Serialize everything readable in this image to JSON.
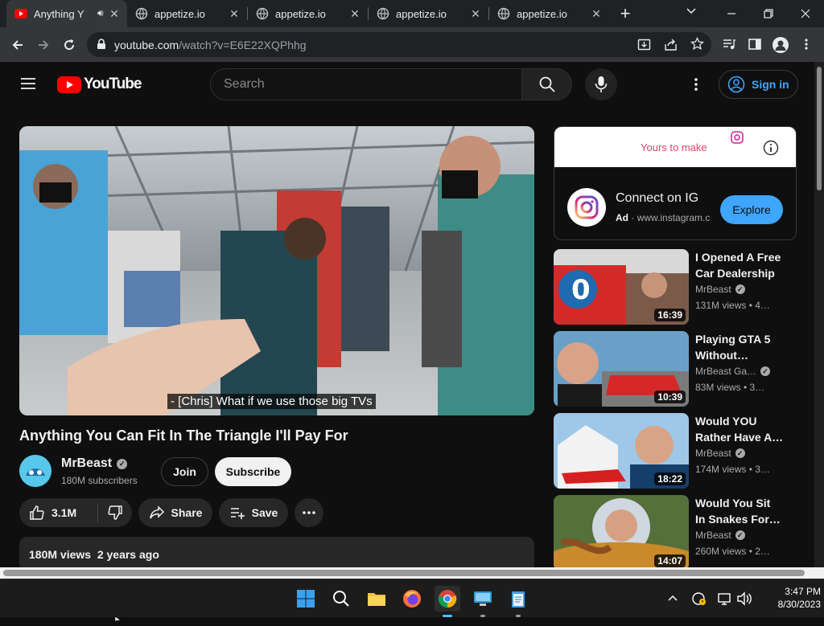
{
  "browser": {
    "tabs": [
      {
        "title": "Anything Yo",
        "active": true
      },
      {
        "title": "appetize.io",
        "active": false
      },
      {
        "title": "appetize.io",
        "active": false
      },
      {
        "title": "appetize.io",
        "active": false
      },
      {
        "title": "appetize.io",
        "active": false
      }
    ],
    "url_host": "youtube.com",
    "url_path": "/watch?v=E6E22XQPhhg"
  },
  "youtube": {
    "logo_text": "YouTube",
    "search_placeholder": "Search",
    "signin_label": "Sign in"
  },
  "video": {
    "caption": "- [Chris] What if we use those big TVs",
    "title": "Anything You Can Fit In The Triangle I'll Pay For",
    "channel_name": "MrBeast",
    "subscribers": "180M subscribers",
    "join_label": "Join",
    "subscribe_label": "Subscribe",
    "likes": "3.1M",
    "share_label": "Share",
    "save_label": "Save",
    "views_date": "180M views  2 years ago"
  },
  "ad": {
    "banner_text": "Yours to make",
    "title": "Connect on IG",
    "ad_label": "Ad",
    "domain": "www.instagram.c",
    "cta_label": "Explore"
  },
  "recommendations": [
    {
      "title_line1": "I Opened A Free",
      "title_line2": "Car Dealership",
      "channel": "MrBeast",
      "meta": "131M views  • 4…",
      "duration": "16:39"
    },
    {
      "title_line1": "Playing GTA 5",
      "title_line2": "Without…",
      "channel": "MrBeast Ga…",
      "meta": "83M views  • 3…",
      "duration": "10:39"
    },
    {
      "title_line1": "Would YOU",
      "title_line2": "Rather Have A…",
      "channel": "MrBeast",
      "meta": "174M views  • 3…",
      "duration": "18:22"
    },
    {
      "title_line1": "Would You Sit",
      "title_line2": "In Snakes For…",
      "channel": "MrBeast",
      "meta": "260M views  • 2…",
      "duration": "14:07"
    }
  ],
  "taskbar": {
    "time": "3:47 PM",
    "date": "8/30/2023"
  },
  "colors": {
    "youtube_red": "#ff0000",
    "link_blue": "#3ea6ff",
    "explore_blue": "#3ea6ff"
  }
}
